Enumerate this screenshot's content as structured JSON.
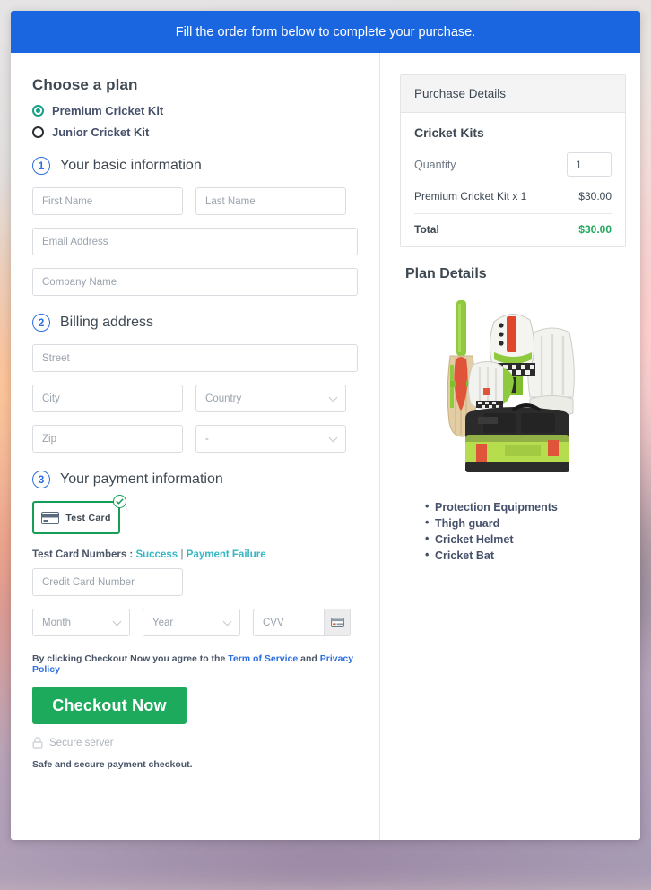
{
  "banner": {
    "text": "Fill the order form below to complete your purchase."
  },
  "plan": {
    "heading": "Choose a plan",
    "options": [
      {
        "label": "Premium Cricket Kit",
        "selected": true
      },
      {
        "label": "Junior Cricket Kit",
        "selected": false
      }
    ]
  },
  "steps": {
    "basic": {
      "num": "1",
      "title": "Your basic information"
    },
    "billing": {
      "num": "2",
      "title": "Billing address"
    },
    "payment": {
      "num": "3",
      "title": "Your payment information"
    }
  },
  "fields": {
    "first_name": "First Name",
    "last_name": "Last Name",
    "email": "Email Address",
    "company": "Company Name",
    "street": "Street",
    "city": "City",
    "country": "Country",
    "zip": "Zip",
    "state": "-",
    "credit_card": "Credit Card Number",
    "month": "Month",
    "year": "Year",
    "cvv": "CVV"
  },
  "payment": {
    "tile_label": "Test Card",
    "tile_icon": "credit-card-icon",
    "tile_badge_icon": "check-circle-icon",
    "test_numbers_label": "Test Card Numbers :",
    "success_link": "Success",
    "separator": "|",
    "failure_link": "Payment Failure",
    "cvv_icon": "credit-card-icon"
  },
  "footer": {
    "agree_prefix": "By clicking Checkout Now you agree to the",
    "terms_link": "Term of Service",
    "agree_mid": "and",
    "privacy_link": "Privacy Policy",
    "checkout_label": "Checkout Now",
    "secure_icon": "lock-icon",
    "secure_text": "Secure server",
    "safe_text": "Safe and secure payment checkout."
  },
  "purchase": {
    "panel_header": "Purchase Details",
    "product_title": "Cricket Kits",
    "quantity_label": "Quantity",
    "quantity_value": "1",
    "line_item_label": "Premium Cricket Kit x 1",
    "line_item_amount": "$30.00",
    "total_label": "Total",
    "total_amount": "$30.00"
  },
  "plan_details": {
    "heading": "Plan Details",
    "image_alt": "cricket-kit-product-image",
    "features": [
      "Protection Equipments",
      "Thigh guard",
      "Cricket Helmet",
      "Cricket Bat"
    ]
  },
  "colors": {
    "banner_blue": "#1a66e0",
    "accent_green": "#1eaa5c",
    "step_blue": "#2d6fe0",
    "link_teal": "#35b7c4"
  }
}
